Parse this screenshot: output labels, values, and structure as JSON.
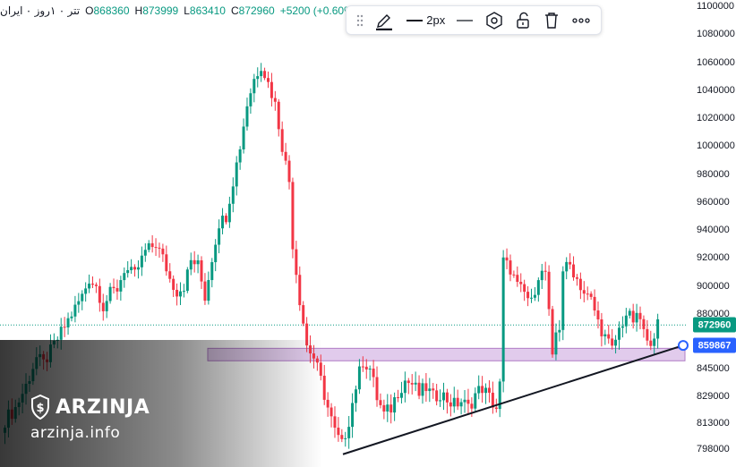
{
  "legend": {
    "title": "تتر ۰ ۱روز ۰ ایران",
    "open_label": "O",
    "open": "868360",
    "high_label": "H",
    "high": "873999",
    "low_label": "L",
    "low": "863410",
    "close_label": "C",
    "close": "872960",
    "change": "+5200 (+0.60%)"
  },
  "toolbar": {
    "line_width_label": "2px",
    "icons": [
      "drag-handle-icon",
      "pencil-icon",
      "line-width-icon",
      "line-style-icon",
      "hexagon-settings-icon",
      "lock-icon",
      "trash-icon",
      "more-icon"
    ]
  },
  "colors": {
    "up": "#089981",
    "down": "#f23645",
    "last_price": "#089981",
    "trendline_handle": "#2962ff",
    "zone": "#c9a0dc"
  },
  "price_scale": {
    "ticks": [
      "1100000",
      "1080000",
      "1060000",
      "1040000",
      "1020000",
      "1000000",
      "980000",
      "960000",
      "940000",
      "920000",
      "900000",
      "880000",
      "845000",
      "829000",
      "813000",
      "798000"
    ],
    "last_price_tag": "872960",
    "trendline_tag": "859867"
  },
  "watermark": {
    "brand": "ARZINJA",
    "url": "arzinja.info"
  },
  "chart_data": {
    "type": "candlestick",
    "title": "",
    "ylabel": "",
    "ylim": [
      790000,
      1102000
    ],
    "last_price": 872960,
    "support_zone": {
      "from": 850000,
      "to": 858000
    },
    "trendline": {
      "start": {
        "bar": 0.5,
        "price": 795000
      },
      "end": {
        "bar": 1.0,
        "price": 859867
      }
    },
    "keypoints": [
      [
        0,
        815000
      ],
      [
        3,
        822000
      ],
      [
        6,
        835000
      ],
      [
        9,
        852000
      ],
      [
        11,
        848000
      ],
      [
        14,
        860000
      ],
      [
        17,
        872000
      ],
      [
        19,
        880000
      ],
      [
        22,
        893000
      ],
      [
        24,
        905000
      ],
      [
        26,
        900000
      ],
      [
        28,
        885000
      ],
      [
        30,
        895000
      ],
      [
        32,
        898000
      ],
      [
        34,
        912000
      ],
      [
        37,
        908000
      ],
      [
        40,
        925000
      ],
      [
        43,
        930000
      ],
      [
        45,
        920000
      ],
      [
        47,
        905000
      ],
      [
        49,
        896000
      ],
      [
        51,
        900000
      ],
      [
        53,
        918000
      ],
      [
        55,
        915000
      ],
      [
        57,
        892000
      ],
      [
        59,
        920000
      ],
      [
        61,
        945000
      ],
      [
        63,
        950000
      ],
      [
        65,
        975000
      ],
      [
        67,
        1000000
      ],
      [
        69,
        1030000
      ],
      [
        71,
        1048000
      ],
      [
        73,
        1058000
      ],
      [
        75,
        1045000
      ],
      [
        77,
        1030000
      ],
      [
        79,
        1000000
      ],
      [
        81,
        975000
      ],
      [
        82,
        930000
      ],
      [
        84,
        890000
      ],
      [
        86,
        860000
      ],
      [
        88,
        852000
      ],
      [
        90,
        838000
      ],
      [
        92,
        822000
      ],
      [
        94,
        808000
      ],
      [
        96,
        800000
      ],
      [
        98,
        815000
      ],
      [
        100,
        835000
      ],
      [
        102,
        850000
      ],
      [
        104,
        845000
      ],
      [
        106,
        828000
      ],
      [
        108,
        818000
      ],
      [
        110,
        822000
      ],
      [
        112,
        832000
      ],
      [
        114,
        838000
      ],
      [
        116,
        836000
      ],
      [
        118,
        830000
      ],
      [
        120,
        834000
      ],
      [
        122,
        828000
      ],
      [
        124,
        831000
      ],
      [
        126,
        827000
      ],
      [
        128,
        824000
      ],
      [
        130,
        826000
      ],
      [
        132,
        822000
      ],
      [
        134,
        830000
      ],
      [
        136,
        834000
      ],
      [
        138,
        828000
      ],
      [
        140,
        822000
      ],
      [
        141,
        835000
      ],
      [
        142,
        918000
      ],
      [
        144,
        912000
      ],
      [
        146,
        900000
      ],
      [
        148,
        895000
      ],
      [
        150,
        888000
      ],
      [
        152,
        908000
      ],
      [
        154,
        910000
      ],
      [
        156,
        850000
      ],
      [
        157,
        868000
      ],
      [
        158,
        872000
      ],
      [
        159,
        912000
      ],
      [
        161,
        915000
      ],
      [
        163,
        905000
      ],
      [
        165,
        895000
      ],
      [
        167,
        890000
      ],
      [
        169,
        875000
      ],
      [
        171,
        865000
      ],
      [
        173,
        857000
      ],
      [
        175,
        870000
      ],
      [
        177,
        880000
      ],
      [
        179,
        876000
      ],
      [
        181,
        877000
      ],
      [
        183,
        860000
      ],
      [
        185,
        868000
      ],
      [
        186,
        872960
      ]
    ]
  }
}
